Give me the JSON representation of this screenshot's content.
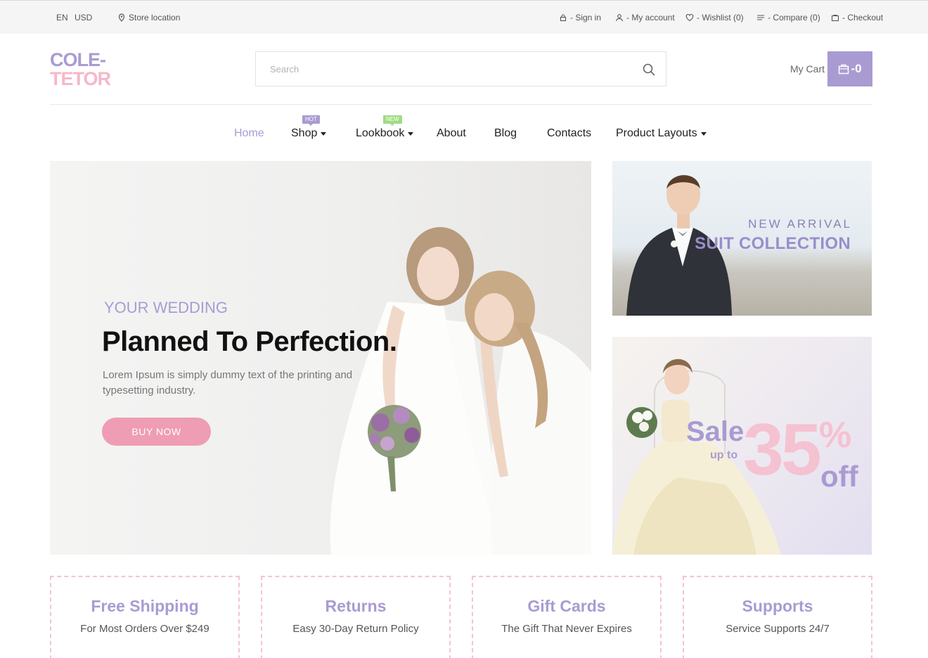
{
  "topbar": {
    "language": "EN",
    "currency": "USD",
    "store_location": "Store location",
    "sign_in": "- Sign in",
    "my_account": "- My account",
    "wishlist": "- Wishlist (0)",
    "compare": "- Compare (0)",
    "checkout": "- Checkout"
  },
  "header": {
    "logo_line1": "COLE-",
    "logo_line2": "TETOR",
    "search_placeholder": "Search",
    "my_cart": "My Cart",
    "cart_count": "-0"
  },
  "nav": {
    "items": [
      {
        "label": "Home"
      },
      {
        "label": "Shop",
        "badge": "HOT"
      },
      {
        "label": "Lookbook",
        "badge": "NEW"
      },
      {
        "label": "About"
      },
      {
        "label": "Blog"
      },
      {
        "label": "Contacts"
      },
      {
        "label": "Product Layouts"
      }
    ]
  },
  "hero": {
    "kicker": "YOUR WEDDING",
    "title": "Planned To Perfection.",
    "text": "Lorem Ipsum is simply dummy text of the printing and typesetting industry.",
    "button": "BUY NOW"
  },
  "banners": {
    "suit_kicker": "NEW ARRIVAL",
    "suit_title": "SUIT COLLECTION",
    "sale": "Sale",
    "up_to": "up to",
    "percent_value": "35",
    "percent_sign": "%",
    "off": "off"
  },
  "features": [
    {
      "title": "Free Shipping",
      "text": "For Most Orders Over $249"
    },
    {
      "title": "Returns",
      "text": "Easy 30-Day Return Policy"
    },
    {
      "title": "Gift Cards",
      "text": "The Gift That Never Expires"
    },
    {
      "title": "Supports",
      "text": "Service Supports 24/7"
    }
  ],
  "colors": {
    "accent_purple": "#a99bd2",
    "accent_pink": "#ee9db4",
    "badge_new": "#9fdc85"
  }
}
